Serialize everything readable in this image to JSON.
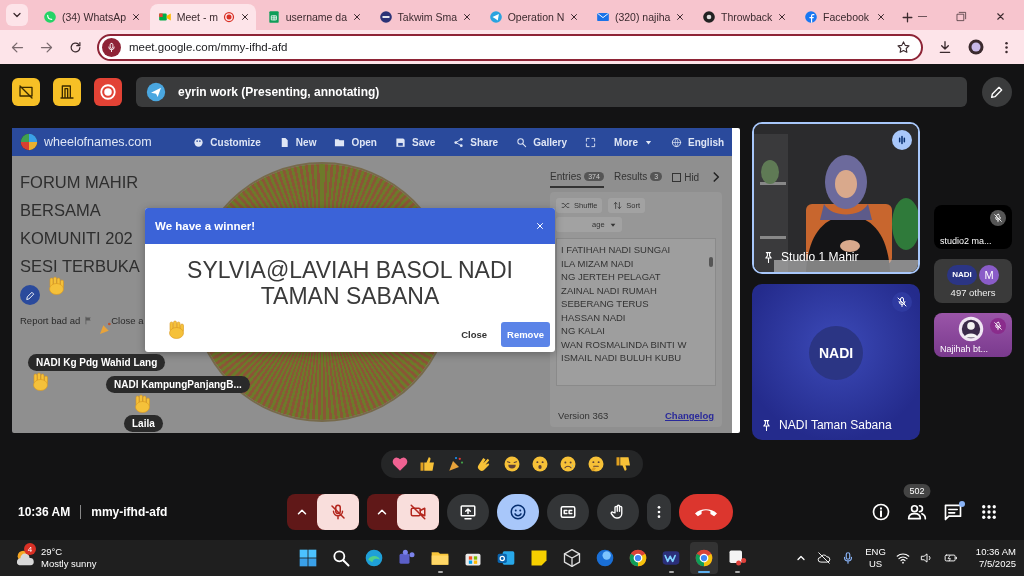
{
  "browser": {
    "tabs": [
      {
        "title": "(34) WhatsAp",
        "kind": "whatsapp",
        "selected": false,
        "recording": false
      },
      {
        "title": "Meet - m",
        "kind": "meet",
        "selected": true,
        "recording": true
      },
      {
        "title": "username da",
        "kind": "sheets",
        "selected": false,
        "recording": false
      },
      {
        "title": "Takwim Sma",
        "kind": "badge",
        "selected": false,
        "recording": false
      },
      {
        "title": "Operation N",
        "kind": "telegram",
        "selected": false,
        "recording": false
      },
      {
        "title": "(320) najiha",
        "kind": "mail",
        "selected": false,
        "recording": false
      },
      {
        "title": "Throwback",
        "kind": "disc",
        "selected": false,
        "recording": false
      },
      {
        "title": "Facebook",
        "kind": "facebook",
        "selected": false,
        "recording": false
      }
    ],
    "url": "meet.google.com/mmy-ifhd-afd"
  },
  "banner": "eyrin work (Presenting, annotating)",
  "presentation": {
    "site": "wheelofnames.com",
    "menu": [
      {
        "label": "Customize",
        "kind": "palette"
      },
      {
        "label": "New",
        "kind": "file"
      },
      {
        "label": "Open",
        "kind": "folder"
      },
      {
        "label": "Save",
        "kind": "disk"
      },
      {
        "label": "Share",
        "kind": "share"
      },
      {
        "label": "Gallery",
        "kind": "search"
      },
      {
        "kind": "fullscreen"
      },
      {
        "label": "More",
        "kind": "more"
      },
      {
        "label": "English",
        "kind": "globe"
      }
    ],
    "title_lines": [
      "FORUM MAHIR",
      "BERSAMA",
      "KOMUNITI 202",
      "SESI TERBUKA"
    ],
    "report": "Report bad ad",
    "close_ad": "Close a",
    "tabs": [
      {
        "label": "Entries",
        "count": "374",
        "selected": true
      },
      {
        "label": "Results",
        "count": "3",
        "selected": false
      }
    ],
    "hide": {
      "label": "Hid",
      "checked": false
    },
    "actions": [
      {
        "label": "Shuffle",
        "kind": "shuffle"
      },
      {
        "label": "Sort",
        "kind": "sort"
      }
    ],
    "dropdown": "age",
    "entries": [
      "I FATIHAH NADI SUNGAI",
      "ILA MIZAM NADI",
      "NG JERTEH PELAGAT",
      "ZAINAL NADI RUMAH",
      "SEBERANG TERUS",
      "HASSAN NADI",
      "NG KALAI",
      "WAN ROSMALINDA BINTI W",
      "ISMAIL NADI BULUH KUBU"
    ],
    "version": "Version 363",
    "changelog": "Changelog",
    "dialog": {
      "title": "We have a winner!",
      "winner_lines": [
        "SYLVIA@LAVIAH BASOL NADI",
        "TAMAN SABANA"
      ],
      "close": "Close",
      "remove": "Remove"
    },
    "name_tags": [
      "NADI Kg Pdg Wahid Lang",
      "NADI KampungPanjangB...",
      "Laila"
    ]
  },
  "tiles": [
    {
      "kind": "video",
      "name": "Studio 1 Mahir",
      "speaking": true,
      "muted": false
    },
    {
      "kind": "logo",
      "name": "NADI Taman Sabana",
      "logo": "NADI",
      "speaking": false,
      "muted": true
    }
  ],
  "side_tiles": [
    {
      "kind": "camera",
      "name": "studio2 ma...",
      "muted": true
    },
    {
      "kind": "group",
      "avatars": [
        "NADI",
        "M"
      ],
      "name": "497 others"
    },
    {
      "kind": "avatar",
      "name": "Najihah bt...",
      "muted": true
    }
  ],
  "footer": {
    "time": "10:36 AM",
    "code": "mmy-ifhd-afd",
    "people_count": "502",
    "chat_unread": true
  },
  "controls": [
    {
      "kind": "mic",
      "on": false
    },
    {
      "kind": "camera",
      "on": false
    },
    {
      "kind": "present"
    },
    {
      "kind": "reactions",
      "selected": true
    },
    {
      "kind": "captions",
      "selected": false
    },
    {
      "kind": "hand",
      "selected": false
    },
    {
      "kind": "more"
    },
    {
      "kind": "leave"
    }
  ],
  "taskbar": {
    "weather_badge": "4",
    "temperature": "29°C",
    "weather": "Mostly sunny",
    "apps": [
      {
        "kind": "start",
        "running": false,
        "focused": false
      },
      {
        "kind": "search",
        "running": false,
        "focused": false
      },
      {
        "kind": "swirl",
        "running": false,
        "focused": false
      },
      {
        "kind": "people",
        "running": false,
        "focused": false
      },
      {
        "kind": "folder",
        "running": true,
        "focused": false
      },
      {
        "kind": "bag",
        "running": false,
        "focused": false
      },
      {
        "kind": "mail",
        "running": false,
        "focused": false
      },
      {
        "kind": "note",
        "running": false,
        "focused": false
      },
      {
        "kind": "cube",
        "running": false,
        "focused": false
      },
      {
        "kind": "orb",
        "running": false,
        "focused": false
      },
      {
        "kind": "ring",
        "running": false,
        "focused": false
      },
      {
        "kind": "wave",
        "running": true,
        "focused": false
      },
      {
        "kind": "ring",
        "running": true,
        "focused": true
      },
      {
        "kind": "scissors",
        "running": true,
        "focused": false
      }
    ],
    "language": "ENG",
    "region": "US",
    "time": "10:36 AM",
    "date": "7/5/2025"
  }
}
